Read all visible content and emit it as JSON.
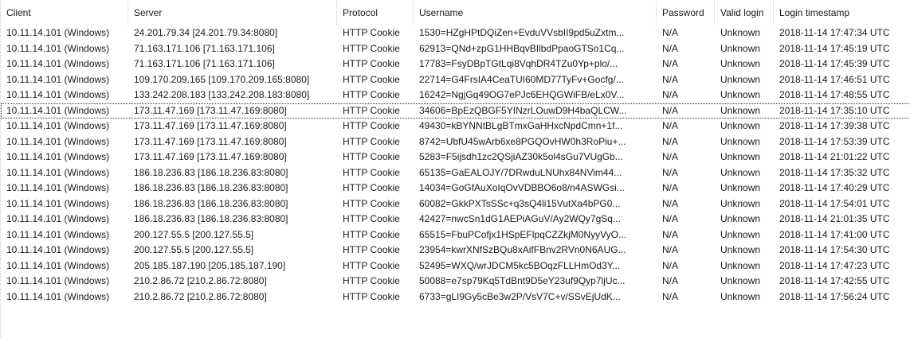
{
  "columns": [
    "Client",
    "Server",
    "Protocol",
    "Username",
    "Password",
    "Valid login",
    "Login timestamp"
  ],
  "rows": [
    [
      "10.11.14.101 (Windows)",
      "24.201.79.34 [24.201.79.34:8080]",
      "HTTP Cookie",
      "1530=HZgHPtDQiZen+EvduVVsbII9pd5uZxtm...",
      "N/A",
      "Unknown",
      "2018-11-14 17:47:34 UTC"
    ],
    [
      "10.11.14.101 (Windows)",
      "71.163.171.106 [71.163.171.106]",
      "HTTP Cookie",
      "62913=QNd+zpG1HHBqvBIlbdPpaoGTSo1Cq...",
      "N/A",
      "Unknown",
      "2018-11-14 17:45:19 UTC"
    ],
    [
      "10.11.14.101 (Windows)",
      "71.163.171.106 [71.163.171.106]",
      "HTTP Cookie",
      "17783=FsyDBpTGtLqi8VqhDR4TZu0Yp+plo/...",
      "N/A",
      "Unknown",
      "2018-11-14 17:45:39 UTC"
    ],
    [
      "10.11.14.101 (Windows)",
      "109.170.209.165 [109.170.209.165:8080]",
      "HTTP Cookie",
      "22714=G4FrsIA4CeaTUI60MD77TyFv+Gocfg/...",
      "N/A",
      "Unknown",
      "2018-11-14 17:46:51 UTC"
    ],
    [
      "10.11.14.101 (Windows)",
      "133.242.208.183 [133.242.208.183:8080]",
      "HTTP Cookie",
      "16242=NgjGq49OG7ePJc6EHQGWiFB/eLx0V...",
      "N/A",
      "Unknown",
      "2018-11-14 17:48:55 UTC"
    ],
    [
      "10.11.14.101 (Windows)",
      "173.11.47.169 [173.11.47.169:8080]",
      "HTTP Cookie",
      "34606=BpEzQBGF5YINzrLOuwD9H4baQLCW...",
      "N/A",
      "Unknown",
      "2018-11-14 17:35:10 UTC"
    ],
    [
      "10.11.14.101 (Windows)",
      "173.11.47.169 [173.11.47.169:8080]",
      "HTTP Cookie",
      "49430=kBYNNtBLgBTmxGaHHxcNpdCmn+1f...",
      "N/A",
      "Unknown",
      "2018-11-14 17:39:38 UTC"
    ],
    [
      "10.11.14.101 (Windows)",
      "173.11.47.169 [173.11.47.169:8080]",
      "HTTP Cookie",
      "8742=UbfU45wArb6xe8PGQOvHW0h3RoPiu+...",
      "N/A",
      "Unknown",
      "2018-11-14 17:53:39 UTC"
    ],
    [
      "10.11.14.101 (Windows)",
      "173.11.47.169 [173.11.47.169:8080]",
      "HTTP Cookie",
      "5283=F5ijsdh1zc2QSjiAZ30k5ol4sGu7VUgGb...",
      "N/A",
      "Unknown",
      "2018-11-14 21:01:22 UTC"
    ],
    [
      "10.11.14.101 (Windows)",
      "186.18.236.83 [186.18.236.83:8080]",
      "HTTP Cookie",
      "65135=GaEALOJY/7DRwduLNUhx84NVim44...",
      "N/A",
      "Unknown",
      "2018-11-14 17:35:32 UTC"
    ],
    [
      "10.11.14.101 (Windows)",
      "186.18.236.83 [186.18.236.83:8080]",
      "HTTP Cookie",
      "14034=GoGfAuXoIqOvVDBBO6o8/n4ASWGsi...",
      "N/A",
      "Unknown",
      "2018-11-14 17:40:29 UTC"
    ],
    [
      "10.11.14.101 (Windows)",
      "186.18.236.83 [186.18.236.83:8080]",
      "HTTP Cookie",
      "60082=GkkPXTsSSc+q3sQ4li15VutXa4bPG0...",
      "N/A",
      "Unknown",
      "2018-11-14 17:54:01 UTC"
    ],
    [
      "10.11.14.101 (Windows)",
      "186.18.236.83 [186.18.236.83:8080]",
      "HTTP Cookie",
      "42427=nwcSn1dG1AEPiAGuV/Ay2WQy7gSq...",
      "N/A",
      "Unknown",
      "2018-11-14 21:01:35 UTC"
    ],
    [
      "10.11.14.101 (Windows)",
      "200.127.55.5 [200.127.55.5]",
      "HTTP Cookie",
      "65515=FbuPCofjx1HSpEFlpqCZZkjM0NyyVyO...",
      "N/A",
      "Unknown",
      "2018-11-14 17:41:00 UTC"
    ],
    [
      "10.11.14.101 (Windows)",
      "200.127.55.5 [200.127.55.5]",
      "HTTP Cookie",
      "23954=kwrXNfSzBQu8xAifFBnv2RVn0N6AUG...",
      "N/A",
      "Unknown",
      "2018-11-14 17:54:30 UTC"
    ],
    [
      "10.11.14.101 (Windows)",
      "205.185.187.190 [205.185.187.190]",
      "HTTP Cookie",
      "52495=WXQ/wrJDCM5kc5BOqzFLLHmOd3Y...",
      "N/A",
      "Unknown",
      "2018-11-14 17:47:23 UTC"
    ],
    [
      "10.11.14.101 (Windows)",
      "210.2.86.72 [210.2.86.72:8080]",
      "HTTP Cookie",
      "50088=e7sp79Kq5TdBnt9D5eY23uf9Qyp7ljUc...",
      "N/A",
      "Unknown",
      "2018-11-14 17:42:55 UTC"
    ],
    [
      "10.11.14.101 (Windows)",
      "210.2.86.72 [210.2.86.72:8080]",
      "HTTP Cookie",
      "6733=gLI9Gy5cBe3w2P/VsV7C+v/SSvEjUdK...",
      "N/A",
      "Unknown",
      "2018-11-14 17:56:24 UTC"
    ]
  ],
  "focused_row": 5
}
